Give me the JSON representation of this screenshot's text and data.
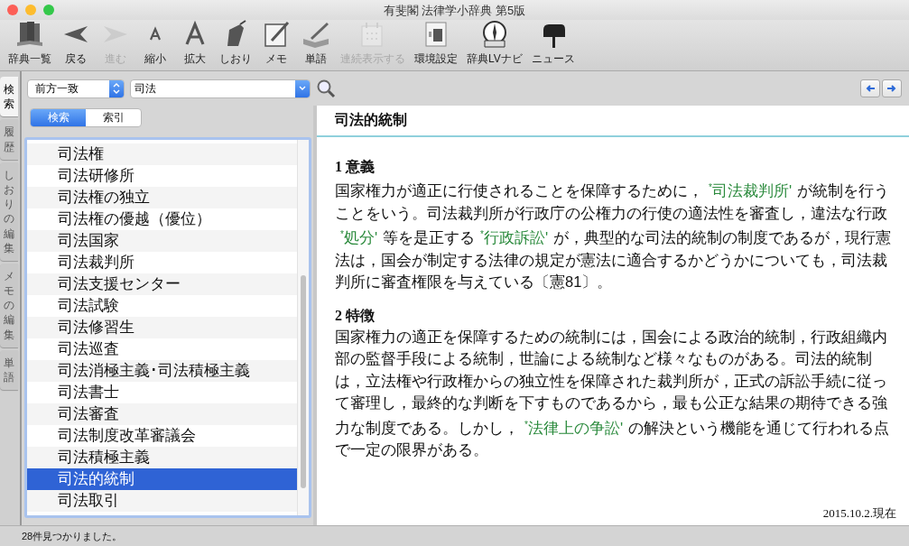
{
  "window": {
    "title": "有斐閣 法律学小辞典 第5版"
  },
  "toolbar": [
    {
      "label": "辞典一覧",
      "disabled": false
    },
    {
      "label": "戻る",
      "disabled": false
    },
    {
      "label": "進む",
      "disabled": true
    },
    {
      "label": "縮小",
      "disabled": false
    },
    {
      "label": "拡大",
      "disabled": false
    },
    {
      "label": "しおり",
      "disabled": false
    },
    {
      "label": "メモ",
      "disabled": false
    },
    {
      "label": "単語",
      "disabled": false
    },
    {
      "label": "連続表示する",
      "disabled": true
    },
    {
      "label": "環境設定",
      "disabled": false
    },
    {
      "label": "辞典LVナビ",
      "disabled": false
    },
    {
      "label": "ニュース",
      "disabled": false
    }
  ],
  "side_tabs": [
    {
      "label": "検索",
      "selected": true
    },
    {
      "label": "履歴",
      "selected": false
    },
    {
      "label": "しおりの編集",
      "selected": false
    },
    {
      "label": "メモの編集",
      "selected": false
    },
    {
      "label": "単語",
      "selected": false
    }
  ],
  "search": {
    "match_mode": "前方一致",
    "query": "司法"
  },
  "mode_tabs": [
    {
      "label": "検索",
      "selected": true
    },
    {
      "label": "索引",
      "selected": false
    }
  ],
  "results": [
    {
      "label": "司法権",
      "selected": false
    },
    {
      "label": "司法研修所",
      "selected": false
    },
    {
      "label": "司法権の独立",
      "selected": false
    },
    {
      "label": "司法権の優越（優位）",
      "selected": false
    },
    {
      "label": "司法国家",
      "selected": false
    },
    {
      "label": "司法裁判所",
      "selected": false
    },
    {
      "label": "司法支援センター",
      "selected": false
    },
    {
      "label": "司法試験",
      "selected": false
    },
    {
      "label": "司法修習生",
      "selected": false
    },
    {
      "label": "司法巡査",
      "selected": false
    },
    {
      "label": "司法消極主義･司法積極主義",
      "selected": false
    },
    {
      "label": "司法書士",
      "selected": false
    },
    {
      "label": "司法審査",
      "selected": false
    },
    {
      "label": "司法制度改革審議会",
      "selected": false
    },
    {
      "label": "司法積極主義",
      "selected": false
    },
    {
      "label": "司法的統制",
      "selected": true
    },
    {
      "label": "司法取引",
      "selected": false
    }
  ],
  "article": {
    "title": "司法的統制",
    "sections": [
      {
        "heading": "1 意義",
        "paragraph": [
          {
            "kind": "text",
            "text": "国家権力が適正に行使されることを保障するために，"
          },
          {
            "kind": "link",
            "text": "$^{*}$司法裁判所'"
          },
          {
            "kind": "text",
            "text": "が統制を行うことをいう。司法裁判所が行政庁の公権力の行使の適法性を審査し，違法な行政"
          },
          {
            "kind": "link",
            "text": "$^{*}$処分'"
          },
          {
            "kind": "text",
            "text": "等を是正する"
          },
          {
            "kind": "link",
            "text": "$^{*}$行政訴訟'"
          },
          {
            "kind": "text",
            "text": "が，典型的な司法的統制の制度であるが，現行憲法は，国会が制定する法律の規定が憲法に適合するかどうかについても，司法裁判所に審査権限を与えている〔憲81〕。"
          }
        ]
      },
      {
        "heading": "2 特徴",
        "paragraph": [
          {
            "kind": "text",
            "text": "国家権力の適正を保障するための統制には，国会による政治的統制，行政組織内部の監督手段による統制，世論による統制など様々なものがある。司法的統制は，立法権や行政権からの独立性を保障された裁判所が，正式の訴訟手続に従って審理し，最終的な判断を下すものであるから，最も公正な結果の期待できる強力な制度である。しかし，"
          },
          {
            "kind": "link",
            "text": "$^{*}$法律上の争訟'"
          },
          {
            "kind": "text",
            "text": "の解決という機能を通じて行われる点で一定の限界がある。"
          }
        ]
      }
    ],
    "date": "2015.10.2.現在"
  },
  "status_bar": "28件見つかりました。"
}
